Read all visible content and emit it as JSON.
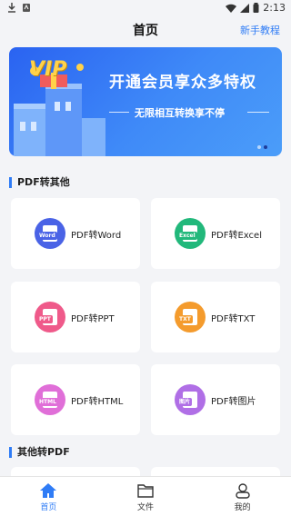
{
  "status_bar": {
    "time": "2:13"
  },
  "header": {
    "title": "首页",
    "tutorial_label": "新手教程"
  },
  "banner": {
    "badge": "VIP",
    "title": "开通会员享众多特权",
    "subtitle": "无限相互转换享不停"
  },
  "section_pdf_to_other": {
    "title": "PDF转其他",
    "items": [
      {
        "label": "PDF转Word",
        "tag": "Word",
        "color": "#4a63e6"
      },
      {
        "label": "PDF转Excel",
        "tag": "Excel",
        "color": "#22b87b"
      },
      {
        "label": "PDF转PPT",
        "tag": "PPT",
        "color": "#ef5a8a"
      },
      {
        "label": "PDF转TXT",
        "tag": "TXT",
        "color": "#f49b2d"
      },
      {
        "label": "PDF转HTML",
        "tag": "HTML",
        "color": "#e06fd8"
      },
      {
        "label": "PDF转图片",
        "tag": "图片",
        "color": "#b06fe6"
      }
    ]
  },
  "section_other_to_pdf": {
    "title": "其他转PDF"
  },
  "bottom_nav": {
    "items": [
      {
        "label": "首页",
        "active": true
      },
      {
        "label": "文件",
        "active": false
      },
      {
        "label": "我的",
        "active": false
      }
    ]
  },
  "colors": {
    "accent": "#2f7cf6",
    "background": "#f3f4f7"
  }
}
